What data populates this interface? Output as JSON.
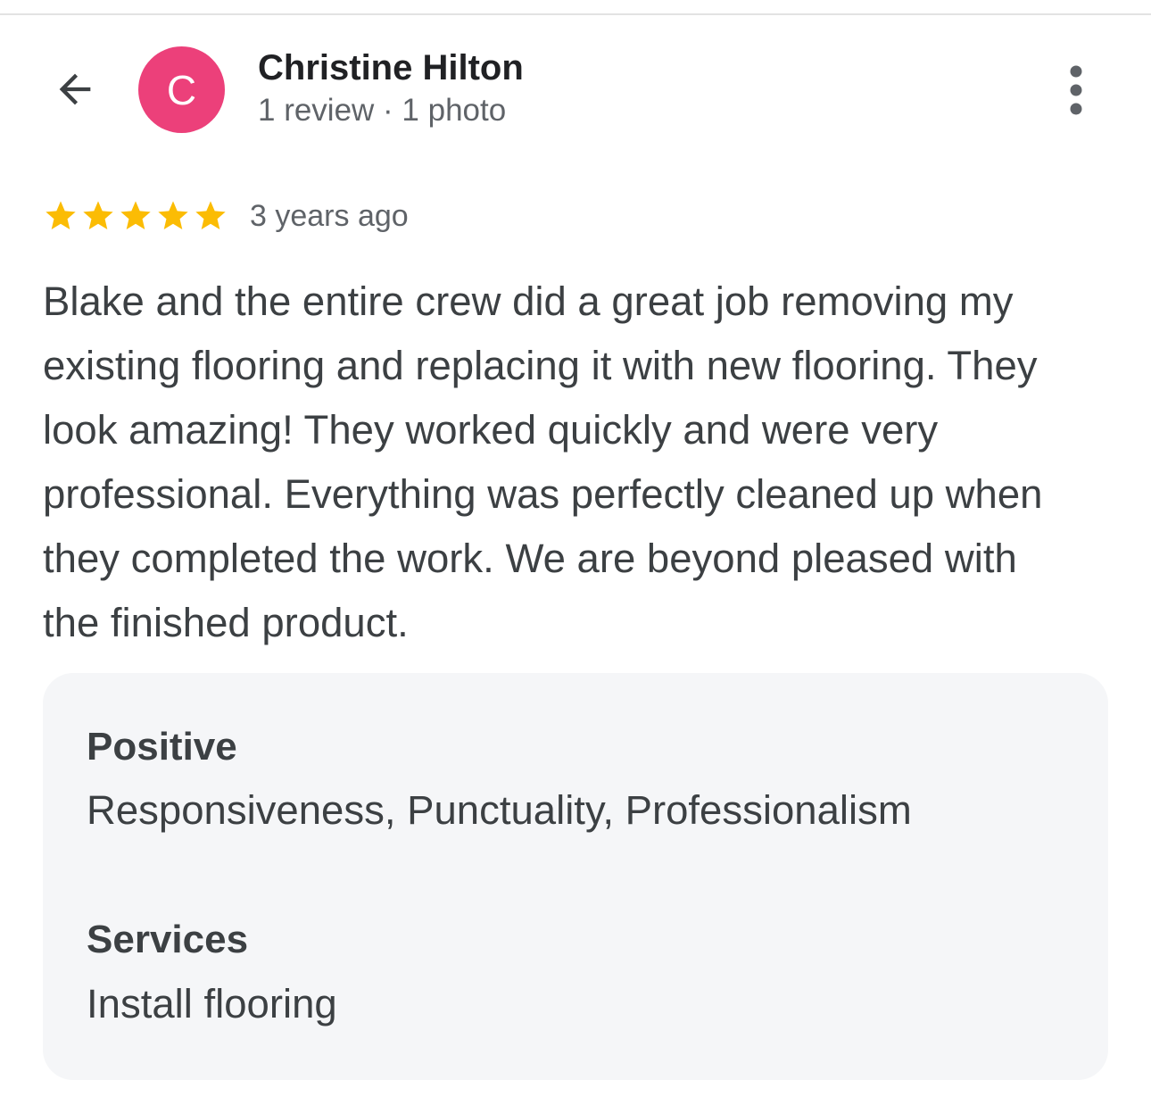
{
  "reviewer": {
    "avatar_initial": "C",
    "avatar_color": "#ec407a",
    "name": "Christine Hilton",
    "meta": "1 review · 1 photo"
  },
  "icons": {
    "back": "arrow-back-icon",
    "more": "more-vert-icon",
    "star": "star-icon"
  },
  "review": {
    "rating": 5,
    "max_rating": 5,
    "star_color": "#fbbc04",
    "date": "3 years ago",
    "lines": [
      "Blake and the entire crew did a great job removing my",
      "existing flooring and replacing it with new flooring. They",
      "look amazing! They worked quickly and were very",
      "professional. Everything was perfectly cleaned up when",
      "they completed the work. We are beyond pleased with",
      "the finished product."
    ]
  },
  "attributes": {
    "positive_label": "Positive",
    "positive_value": "Responsiveness, Punctuality, Professionalism",
    "services_label": "Services",
    "services_value": "Install flooring"
  }
}
